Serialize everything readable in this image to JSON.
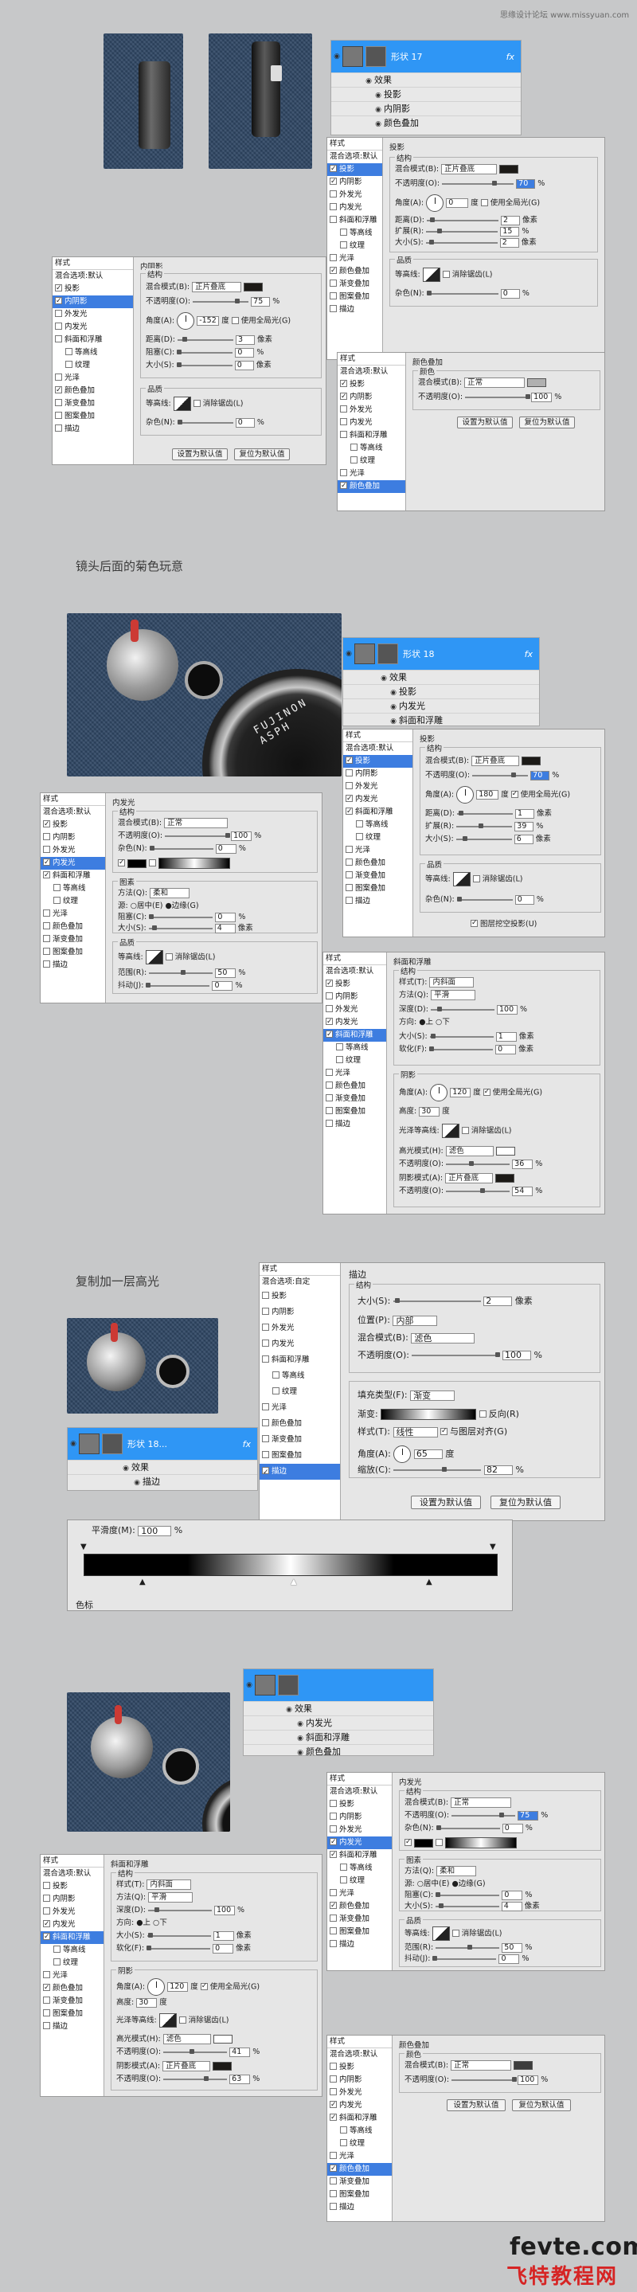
{
  "watermark": "思缘设计论坛 www.missyuan.com",
  "captions": [
    "镜头后面的菊色玩意",
    "复制加一层高光"
  ],
  "footer": {
    "logo": "fevte.com",
    "sub": "飞特教程网"
  },
  "lens_text": "FUJINON ASPH",
  "layers": {
    "panel1": {
      "name": "形状 17",
      "fx": "fx",
      "effects": [
        "效果",
        "投影",
        "内阴影",
        "颜色叠加"
      ]
    },
    "panel2": {
      "name": "形状 18",
      "fx": "fx",
      "effects": [
        "效果",
        "投影",
        "内发光",
        "斜面和浮雕"
      ]
    },
    "panel3": {
      "name": "形状 18...",
      "fx": "fx",
      "effects": [
        "效果",
        "描边"
      ]
    },
    "panel4": {
      "effects": [
        "效果",
        "内发光",
        "斜面和浮雕",
        "颜色叠加"
      ]
    }
  },
  "styles": {
    "header": "样式",
    "blend": "混合选项:默认",
    "blend_custom": "混合选项:自定",
    "items": [
      "投影",
      "内阴影",
      "外发光",
      "内发光",
      "斜面和浮雕",
      "等高线",
      "纹理",
      "光泽",
      "颜色叠加",
      "渐变叠加",
      "图案叠加",
      "描边"
    ]
  },
  "labels": {
    "drop_shadow": "投影",
    "inner_shadow": "内阴影",
    "inner_glow": "内发光",
    "bevel": "斜面和浮雕",
    "color_overlay": "颜色叠加",
    "stroke": "描边",
    "structure": "结构",
    "quality": "品质",
    "elements": "图素",
    "shading": "阴影",
    "color": "颜色",
    "blend_mode": "混合模式(B):",
    "opacity": "不透明度(O):",
    "angle": "角度(A):",
    "use_global": "使用全局光(G)",
    "distance": "距离(D):",
    "choke": "阻塞(C):",
    "spread": "扩展(R):",
    "size": "大小(S):",
    "contour": "等高线:",
    "anti_alias": "消除锯齿(L)",
    "noise": "杂色(N):",
    "make_default": "设置为默认值",
    "reset_default": "复位为默认值",
    "knockout": "图层挖空投影(U)",
    "technique": "方法(Q):",
    "source": "源:",
    "center": "居中(E)",
    "edge": "边缘(G)",
    "range": "范围(R):",
    "jitter": "抖动(J):",
    "style": "样式(T):",
    "depth": "深度(D):",
    "direction": "方向:",
    "up": "上",
    "down": "下",
    "soften": "软化(F):",
    "altitude": "高度:",
    "gloss_contour": "光泽等高线:",
    "highlight_mode": "高光模式(H):",
    "shadow_mode": "阴影模式(A):",
    "position": "位置(P):",
    "fill_type": "填充类型(F):",
    "gradient": "渐变:",
    "reverse": "反向(R)",
    "align": "与图层对齐(G)",
    "scale": "缩放(C):",
    "smoothness": "平滑度(M):",
    "color_stop": "色标",
    "px": "像素",
    "pct": "%",
    "deg": "度"
  },
  "values": {
    "normal": "正常",
    "multiply": "正片叠底",
    "screen": "滤色",
    "softer": "柔和",
    "inner_bevel": "内斜面",
    "smooth": "平滑",
    "inside": "内部",
    "gradient": "渐变",
    "linear": "线性",
    "is_opacity": "75",
    "is_angle": "-152",
    "is_dist": "3",
    "is_choke": "0",
    "is_size": "0",
    "is_noise": "0",
    "ds_opacity": "70",
    "ds_angle": "0",
    "ds_dist": "2",
    "ds_spread": "15",
    "ds_size": "2",
    "ds_noise": "0",
    "co_opacity": "100",
    "ig_opacity": "100",
    "ig_noise": "0",
    "ig_choke": "0",
    "ig_size": "4",
    "ig_range": "50",
    "ig_jitter": "0",
    "ds2_opacity": "70",
    "ds2_angle": "180",
    "ds2_dist": "1",
    "ds2_spread": "39",
    "ds2_size": "6",
    "ds2_noise": "0",
    "bv_depth": "100",
    "bv_size": "1",
    "bv_soften": "0",
    "bv_angle": "120",
    "bv_alt": "30",
    "bv_hl": "36",
    "bv_sh": "54",
    "st_size": "2",
    "st_opacity": "100",
    "st_angle": "65",
    "st_scale": "82",
    "smooth_val": "100",
    "bv4_depth": "100",
    "bv4_size": "1",
    "bv4_soften": "0",
    "bv4_angle": "120",
    "bv4_alt": "30",
    "bv4_hl": "41",
    "bv4_sh": "63",
    "ig4_opacity": "75",
    "ig4_noise": "0",
    "ig4_choke": "0",
    "ig4_size": "4",
    "ig4_range": "50",
    "ig4_jitter": "0",
    "co4_opacity": "100"
  },
  "colors": {
    "accent": "#2f96f5",
    "dark_swatch": "#1c1a17",
    "gray_swatch": "#b0b0b0",
    "white_swatch": "#ffffff",
    "denim": "#2f4764"
  }
}
